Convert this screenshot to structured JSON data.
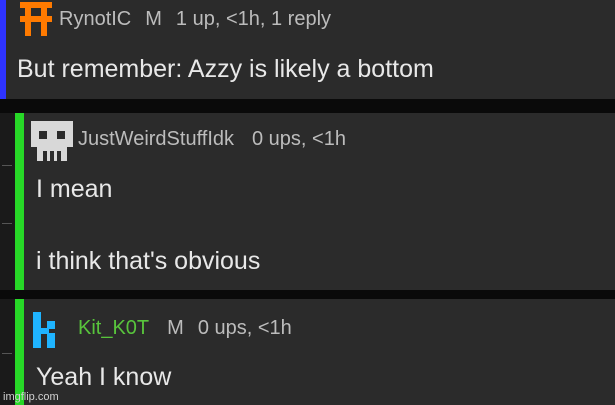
{
  "comments": [
    {
      "username": "RynotIC",
      "mod_badge": "M",
      "meta": "1 up, <1h, 1 reply",
      "body": [
        "But remember: Azzy is likely a bottom"
      ],
      "accent": "#2e33ff",
      "avatar_color": "#ff7a00",
      "avatar_icon": "orange-logo-icon"
    },
    {
      "username": "JustWeirdStuffIdk",
      "mod_badge": "",
      "meta": "0 ups, <1h",
      "body": [
        "I mean",
        "i think that's obvious"
      ],
      "accent": "#27d827",
      "avatar_color": "#d8d8d8",
      "avatar_icon": "skull-pixel-icon"
    },
    {
      "username": "Kit_K0T",
      "mod_badge": "M",
      "meta": "0 ups, <1h",
      "body": [
        "Yeah I know"
      ],
      "accent": "#27d827",
      "avatar_color": "#1fb4ff",
      "avatar_icon": "k-letter-icon"
    }
  ],
  "watermark": "imgflip.com"
}
